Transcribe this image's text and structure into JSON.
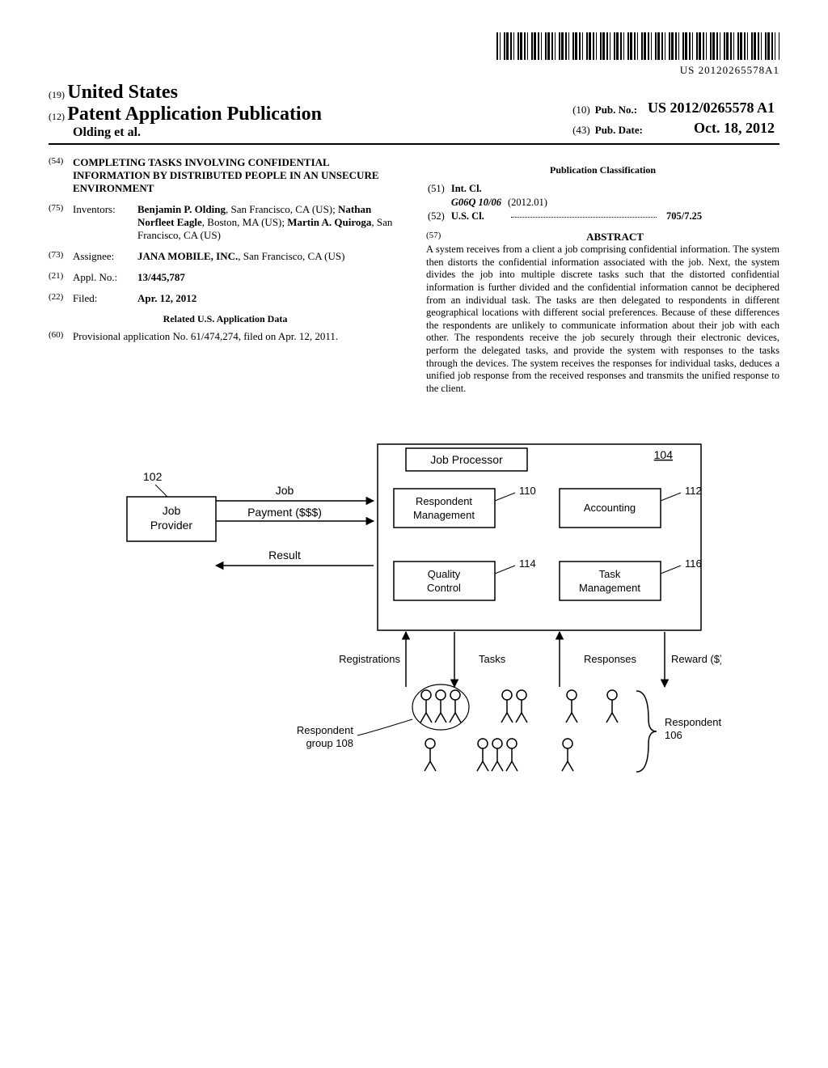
{
  "barcode_text": "US 20120265578A1",
  "header": {
    "code19": "(19)",
    "country": "United States",
    "code12": "(12)",
    "pub_type": "Patent Application Publication",
    "authors": "Olding et al.",
    "code10": "(10)",
    "pubno_label": "Pub. No.:",
    "pubno_value": "US 2012/0265578 A1",
    "code43": "(43)",
    "pubdate_label": "Pub. Date:",
    "pubdate_value": "Oct. 18, 2012"
  },
  "left_fields": {
    "f54": {
      "code": "(54)",
      "title": "COMPLETING TASKS INVOLVING CONFIDENTIAL INFORMATION BY DISTRIBUTED PEOPLE IN AN UNSECURE ENVIRONMENT"
    },
    "f75": {
      "code": "(75)",
      "label": "Inventors:",
      "value": "Benjamin P. Olding, San Francisco, CA (US); Nathan Norfleet Eagle, Boston, MA (US); Martin A. Quiroga, San Francisco, CA (US)"
    },
    "f73": {
      "code": "(73)",
      "label": "Assignee:",
      "value": "JANA MOBILE, INC., San Francisco, CA (US)"
    },
    "f21": {
      "code": "(21)",
      "label": "Appl. No.:",
      "value": "13/445,787"
    },
    "f22": {
      "code": "(22)",
      "label": "Filed:",
      "value": "Apr. 12, 2012"
    },
    "related_heading": "Related U.S. Application Data",
    "f60": {
      "code": "(60)",
      "value": "Provisional application No. 61/474,274, filed on Apr. 12, 2011."
    }
  },
  "right_fields": {
    "pub_class_heading": "Publication Classification",
    "f51": {
      "code": "(51)",
      "label": "Int. Cl.",
      "class": "G06Q 10/06",
      "date": "(2012.01)"
    },
    "f52": {
      "code": "(52)",
      "label": "U.S. Cl.",
      "value": "705/7.25"
    },
    "f57": {
      "code": "(57)",
      "heading": "ABSTRACT"
    },
    "abstract_text": "A system receives from a client a job comprising confidential information. The system then distorts the confidential information associated with the job. Next, the system divides the job into multiple discrete tasks such that the distorted confidential information is further divided and the confidential information cannot be deciphered from an individual task. The tasks are then delegated to respondents in different geographical locations with different social preferences. Because of these differences the respondents are unlikely to communicate information about their job with each other. The respondents receive the job securely through their electronic devices, perform the delegated tasks, and provide the system with responses to the tasks through the devices. The system receives the responses for individual tasks, deduces a unified job response from the received responses and transmits the unified response to the client."
  },
  "diagram": {
    "job_provider": "Job\nProvider",
    "ref102": "102",
    "arrow_job": "Job",
    "arrow_payment": "Payment ($$$)",
    "arrow_result": "Result",
    "job_processor": "Job Processor",
    "ref104": "104",
    "respondent_mgmt": "Respondent\nManagement",
    "ref110": "110",
    "accounting": "Accounting",
    "ref112": "112",
    "quality_control": "Quality\nControl",
    "ref114": "114",
    "task_mgmt": "Task\nManagement",
    "ref116": "116",
    "registrations": "Registrations",
    "tasks": "Tasks",
    "responses": "Responses",
    "reward": "Reward ($)",
    "respondent_group": "Respondent\ngroup 108",
    "respondents": "Respondents\n106"
  }
}
